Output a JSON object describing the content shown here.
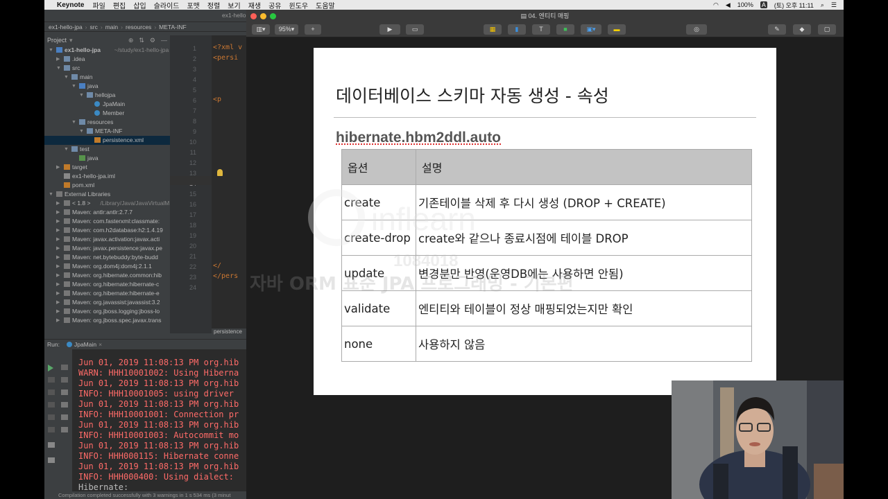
{
  "menubar": {
    "app_name": "Keynote",
    "items": [
      "파일",
      "편집",
      "삽입",
      "슬라이드",
      "포맷",
      "정렬",
      "보기",
      "재생",
      "공유",
      "윈도우",
      "도움말"
    ],
    "battery": "100%",
    "input_source": "A",
    "clock": "(토) 오후 11:11"
  },
  "ide": {
    "window_title": "ex1-hello",
    "breadcrumbs": [
      "ex1-hello-jpa",
      "src",
      "main",
      "resources",
      "META-INF"
    ],
    "project_label": "Project",
    "tree": [
      {
        "label": "ex1-hello-jpa",
        "suffix": "~/study/ex1-hello-jpa",
        "indent": 0,
        "type": "fold-blue",
        "arrow": "▼"
      },
      {
        "label": ".idea",
        "indent": 1,
        "type": "fold",
        "arrow": "▶"
      },
      {
        "label": "src",
        "indent": 1,
        "type": "fold",
        "arrow": "▼"
      },
      {
        "label": "main",
        "indent": 2,
        "type": "fold",
        "arrow": "▼"
      },
      {
        "label": "java",
        "indent": 3,
        "type": "fold-blue",
        "arrow": "▼"
      },
      {
        "label": "hellojpa",
        "indent": 4,
        "type": "fold",
        "arrow": "▼"
      },
      {
        "label": "JpaMain",
        "indent": 5,
        "type": "file-java",
        "arrow": ""
      },
      {
        "label": "Member",
        "indent": 5,
        "type": "file-java",
        "arrow": ""
      },
      {
        "label": "resources",
        "indent": 3,
        "type": "fold",
        "arrow": "▼"
      },
      {
        "label": "META-INF",
        "indent": 4,
        "type": "fold",
        "arrow": "▼"
      },
      {
        "label": "persistence.xml",
        "indent": 5,
        "type": "file-xml",
        "arrow": "",
        "selected": true
      },
      {
        "label": "test",
        "indent": 2,
        "type": "fold",
        "arrow": "▼"
      },
      {
        "label": "java",
        "indent": 3,
        "type": "fold-green",
        "arrow": ""
      },
      {
        "label": "target",
        "indent": 1,
        "type": "fold-orange",
        "arrow": "▶"
      },
      {
        "label": "ex1-hello-jpa.iml",
        "indent": 1,
        "type": "file-iml",
        "arrow": ""
      },
      {
        "label": "pom.xml",
        "indent": 1,
        "type": "file-xml",
        "arrow": ""
      },
      {
        "label": "External Libraries",
        "indent": 0,
        "type": "lib",
        "arrow": "▼"
      },
      {
        "label": "< 1.8 >",
        "suffix": "/Library/Java/JavaVirtualM",
        "indent": 1,
        "type": "lib",
        "arrow": "▶"
      },
      {
        "label": "Maven: antlr:antlr:2.7.7",
        "indent": 1,
        "type": "lib",
        "arrow": "▶"
      },
      {
        "label": "Maven: com.fasterxml:classmate:",
        "indent": 1,
        "type": "lib",
        "arrow": "▶"
      },
      {
        "label": "Maven: com.h2database:h2:1.4.19",
        "indent": 1,
        "type": "lib",
        "arrow": "▶"
      },
      {
        "label": "Maven: javax.activation:javax.acti",
        "indent": 1,
        "type": "lib",
        "arrow": "▶"
      },
      {
        "label": "Maven: javax.persistence:javax.pe",
        "indent": 1,
        "type": "lib",
        "arrow": "▶"
      },
      {
        "label": "Maven: net.bytebuddy:byte-budd",
        "indent": 1,
        "type": "lib",
        "arrow": "▶"
      },
      {
        "label": "Maven: org.dom4j:dom4j:2.1.1",
        "indent": 1,
        "type": "lib",
        "arrow": "▶"
      },
      {
        "label": "Maven: org.hibernate.common:hib",
        "indent": 1,
        "type": "lib",
        "arrow": "▶"
      },
      {
        "label": "Maven: org.hibernate:hibernate-c",
        "indent": 1,
        "type": "lib",
        "arrow": "▶"
      },
      {
        "label": "Maven: org.hibernate:hibernate-e",
        "indent": 1,
        "type": "lib",
        "arrow": "▶"
      },
      {
        "label": "Maven: org.javassist:javassist:3.2",
        "indent": 1,
        "type": "lib",
        "arrow": "▶"
      },
      {
        "label": "Maven: org.jboss.logging:jboss-lo",
        "indent": 1,
        "type": "lib",
        "arrow": "▶"
      },
      {
        "label": "Maven: org.jboss.spec.javax.trans",
        "indent": 1,
        "type": "lib",
        "arrow": "▶"
      }
    ],
    "line_numbers": [
      "1",
      "2",
      "3",
      "4",
      "5",
      "6",
      "7",
      "8",
      "9",
      "10",
      "11",
      "12",
      "13",
      "14",
      "15",
      "16",
      "17",
      "18",
      "19",
      "20",
      "21",
      "22",
      "23",
      "24"
    ],
    "code_lines": [
      {
        "line": 1,
        "text": "<?xml v"
      },
      {
        "line": 2,
        "text": "<persi"
      },
      {
        "line": 6,
        "text": "  <p"
      },
      {
        "line": 22,
        "text": "  </"
      },
      {
        "line": 23,
        "text": "</pers"
      }
    ],
    "editor_tab": "persistence",
    "run_label": "Run:",
    "run_tab": "JpaMain",
    "console": [
      {
        "text": "Jun 01, 2019 11:08:13 PM org.hib",
        "kind": "err"
      },
      {
        "text": "WARN: HHH10001002: Using Hiberna",
        "kind": "err"
      },
      {
        "text": "Jun 01, 2019 11:08:13 PM org.hib",
        "kind": "err"
      },
      {
        "text": "INFO: HHH10001005: using driver ",
        "kind": "err"
      },
      {
        "text": "Jun 01, 2019 11:08:13 PM org.hib",
        "kind": "err"
      },
      {
        "text": "INFO: HHH10001001: Connection pr",
        "kind": "err"
      },
      {
        "text": "Jun 01, 2019 11:08:13 PM org.hib",
        "kind": "err"
      },
      {
        "text": "INFO: HHH10001003: Autocommit mo",
        "kind": "err"
      },
      {
        "text": "Jun 01, 2019 11:08:13 PM org.hib",
        "kind": "err"
      },
      {
        "text": "INFO: HHH000115: Hibernate conne",
        "kind": "err"
      },
      {
        "text": "Jun 01, 2019 11:08:13 PM org.hib",
        "kind": "err"
      },
      {
        "text": "INFO: HHH000400: Using dialect: ",
        "kind": "err"
      },
      {
        "text": "Hibernate:",
        "kind": "norm"
      }
    ],
    "status": "Compilation completed successfully with 3 warnings in 1 s 534 ms (3 minut"
  },
  "keynote": {
    "window_title": "04. 엔티티 매핑",
    "zoom": "95%",
    "slide": {
      "title": "데이터베이스 스키마 자동 생성 - 속성",
      "subtitle": "hibernate.hbm2ddl.auto",
      "table_headers": [
        "옵션",
        "설명"
      ],
      "rows": [
        {
          "option": "create",
          "desc": "기존테이블 삭제 후 다시 생성 (DROP + CREATE)"
        },
        {
          "option": "create-drop",
          "desc": "create와 같으나 종료시점에 테이블 DROP"
        },
        {
          "option": "update",
          "desc": "변경분만 반영(운영DB에는 사용하면 안됨)"
        },
        {
          "option": "validate",
          "desc": "엔티티와 테이블이 정상 매핑되었는지만 확인"
        },
        {
          "option": "none",
          "desc": "사용하지 않음"
        }
      ]
    }
  },
  "watermark": {
    "brand": "inflearn",
    "id": "1084018",
    "line": "자바 ORM 표준 JPA 프로그래밍 - 기본편"
  }
}
